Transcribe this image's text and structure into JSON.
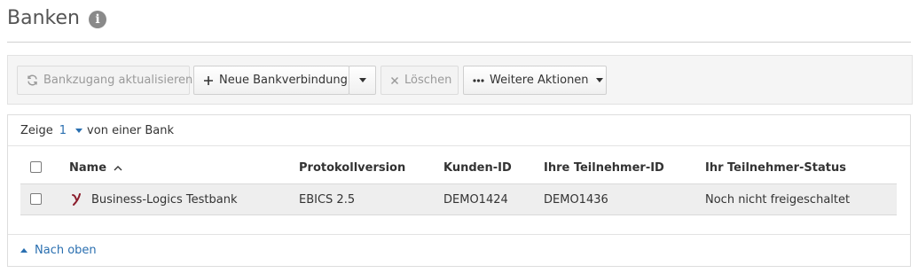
{
  "page": {
    "title": "Banken"
  },
  "toolbar": {
    "refresh_label": "Bankzugang aktualisieren",
    "new_connection_label": "Neue Bankverbindung",
    "delete_label": "Löschen",
    "more_actions_label": "Weitere Aktionen"
  },
  "summary": {
    "prefix": "Zeige",
    "count": "1",
    "suffix": "von einer Bank"
  },
  "table": {
    "columns": [
      "Name",
      "Protokollversion",
      "Kunden-ID",
      "Ihre Teilnehmer-ID",
      "Ihr Teilnehmer-Status"
    ],
    "rows": [
      {
        "name": "Business-Logics Testbank",
        "protocol": "EBICS 2.5",
        "customer_id": "DEMO1424",
        "participant_id": "DEMO1436",
        "status": "Noch nicht freigeschaltet"
      }
    ]
  },
  "footer": {
    "back_to_top": "Nach oben"
  },
  "colors": {
    "accent": "#2a6fb0",
    "bank_logo": "#8b1d2c",
    "muted": "#9a9a9a"
  },
  "icons": {
    "info": "info-icon",
    "refresh": "refresh-icon",
    "plus": "plus-icon",
    "close": "close-icon",
    "more": "ellipsis-icon",
    "sort": "sort-ascending-icon",
    "bank_logo": "bank-logo-icon"
  }
}
